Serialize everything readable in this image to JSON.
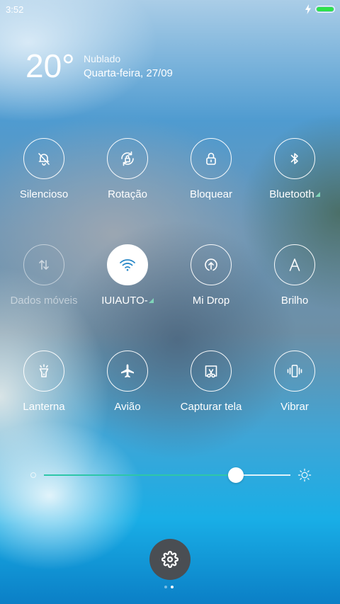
{
  "status_bar": {
    "time": "3:52",
    "charging_icon": "lightning-icon",
    "battery_color": "#2ee24a"
  },
  "weather": {
    "temperature": "20°",
    "condition": "Nublado",
    "date": "Quarta-feira, 27/09"
  },
  "toggles": [
    {
      "label": "Silencioso",
      "icon": "bell-off-icon",
      "state": "off"
    },
    {
      "label": "Rotação",
      "icon": "rotation-lock-icon",
      "state": "off"
    },
    {
      "label": "Bloquear",
      "icon": "lock-icon",
      "state": "off"
    },
    {
      "label": "Bluetooth",
      "icon": "bluetooth-icon",
      "state": "off",
      "has_submenu": true
    },
    {
      "label": "Dados móveis",
      "icon": "mobile-data-icon",
      "state": "disabled"
    },
    {
      "label": "IUIAUTO-",
      "icon": "wifi-icon",
      "state": "on",
      "has_submenu": true
    },
    {
      "label": "Mi Drop",
      "icon": "mi-drop-icon",
      "state": "off"
    },
    {
      "label": "Brilho",
      "icon": "auto-brightness-icon",
      "state": "off"
    },
    {
      "label": "Lanterna",
      "icon": "flashlight-icon",
      "state": "off"
    },
    {
      "label": "Avião",
      "icon": "airplane-icon",
      "state": "off"
    },
    {
      "label": "Capturar tela",
      "icon": "screenshot-icon",
      "state": "off"
    },
    {
      "label": "Vibrar",
      "icon": "vibrate-icon",
      "state": "off"
    }
  ],
  "brightness": {
    "level": 0.78,
    "accent_color": "#2ec7a8"
  },
  "settings_button": {
    "icon": "gear-icon"
  },
  "pager": {
    "pages": 2,
    "current": 2
  }
}
